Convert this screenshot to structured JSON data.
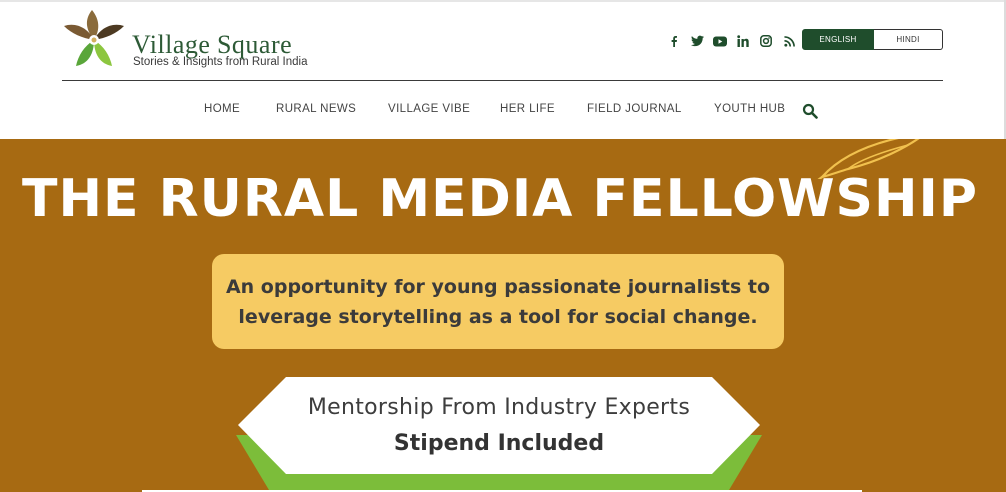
{
  "brand": {
    "title_first": "Village",
    "title_second": "Square",
    "tagline": "Stories & Insights from Rural India",
    "logo_icon": "leaf-flower-logo"
  },
  "social_icons": [
    "facebook-icon",
    "twitter-icon",
    "youtube-icon",
    "linkedin-icon",
    "instagram-icon",
    "rss-icon"
  ],
  "language": {
    "english": "ENGLISH",
    "hindi": "HINDI",
    "selected": "ENGLISH"
  },
  "nav": {
    "items": [
      "HOME",
      "RURAL NEWS",
      "VILLAGE VIBE",
      "HER LIFE",
      "FIELD JOURNAL",
      "YOUTH HUB"
    ],
    "search_icon": "search-icon"
  },
  "banner": {
    "title": "THE RURAL MEDIA FELLOWSHIP",
    "subtitle_line1": "An opportunity for young passionate journalists to",
    "subtitle_line2": "leverage storytelling as a tool for social change.",
    "mentorship": "Mentorship From Industry Experts",
    "stipend": "Stipend Included",
    "colors": {
      "background": "#a76a12",
      "highlight": "#f6cb63",
      "accent_green": "#7cbd3a"
    }
  },
  "colors": {
    "brand_green": "#2d5a36",
    "button_dark": "#1f4d2c"
  }
}
